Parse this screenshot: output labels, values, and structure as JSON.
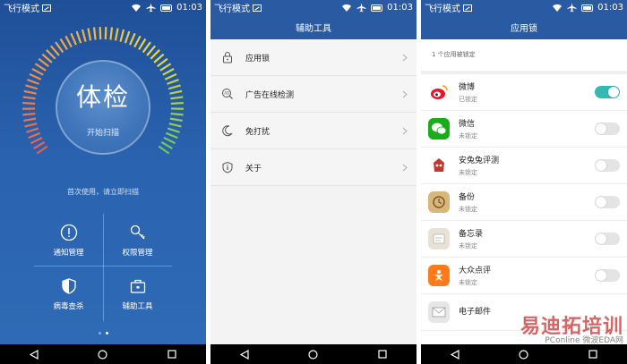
{
  "statusbar": {
    "carrier": "飞行模式",
    "time": "01:03"
  },
  "screen1": {
    "gauge_title": "体检",
    "gauge_subtitle": "开始扫描",
    "hint": "首次使用，请立即扫描",
    "tiles": [
      {
        "label": "通知管理",
        "icon": "exclamation-circle-icon"
      },
      {
        "label": "权限管理",
        "icon": "key-icon"
      },
      {
        "label": "病毒查杀",
        "icon": "shield-icon"
      },
      {
        "label": "辅助工具",
        "icon": "toolbox-icon"
      }
    ]
  },
  "screen2": {
    "title": "辅助工具",
    "items": [
      {
        "label": "应用锁",
        "icon": "lock-icon"
      },
      {
        "label": "广告在线检测",
        "icon": "ad-detect-icon"
      },
      {
        "label": "免打扰",
        "icon": "moon-icon"
      },
      {
        "label": "关于",
        "icon": "info-icon"
      }
    ]
  },
  "screen3": {
    "title": "应用锁",
    "lock_count": "1 个应用被锁定",
    "apps": [
      {
        "name": "微博",
        "status": "已锁定",
        "locked": true,
        "color": "#e6162d"
      },
      {
        "name": "微信",
        "status": "未锁定",
        "locked": false,
        "color": "#1aad19"
      },
      {
        "name": "安兔兔评测",
        "status": "未锁定",
        "locked": false,
        "color": "#c0392b"
      },
      {
        "name": "备份",
        "status": "未锁定",
        "locked": false,
        "color": "#d9b77a"
      },
      {
        "name": "备忘录",
        "status": "未锁定",
        "locked": false,
        "color": "#e8e2d6"
      },
      {
        "name": "大众点评",
        "status": "未锁定",
        "locked": false,
        "color": "#ff7a1a"
      },
      {
        "name": "电子邮件",
        "status": "",
        "locked": false,
        "color": "#dddddd"
      }
    ]
  },
  "watermark": {
    "main": "易迪拓培训",
    "sub": "PConline 微波EDA网"
  },
  "colors": {
    "accent": "#2a5aa2",
    "toggle_on": "#35b8b2"
  }
}
